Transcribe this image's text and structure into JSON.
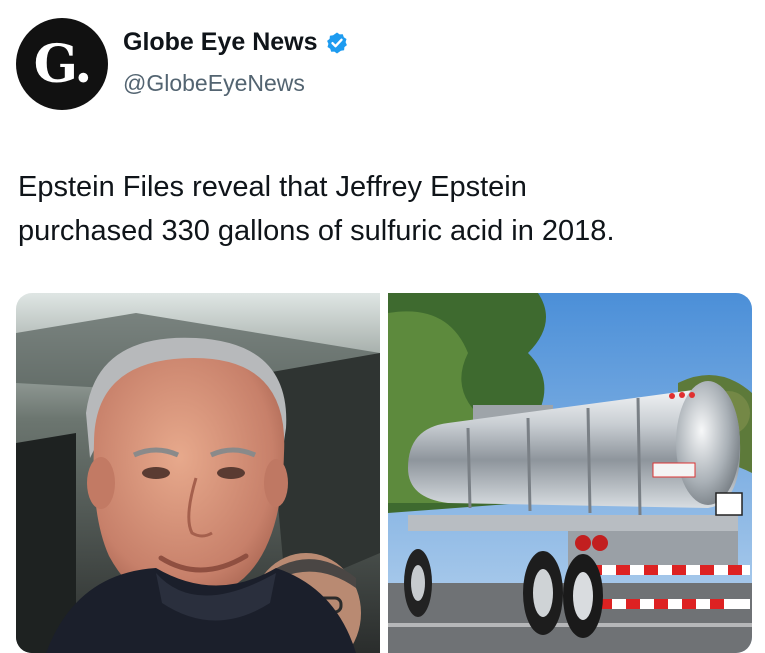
{
  "account": {
    "avatar_text": "G.",
    "display_name": "Globe Eye News",
    "handle": "@GlobeEyeNews",
    "verified": true,
    "verified_color": "#1d9bf0"
  },
  "post": {
    "text_line1": "Epstein Files reveal that Jeffrey Epstein",
    "text_line2": "purchased 330 gallons of sulfuric acid in 2018."
  },
  "media": {
    "image1": "portrait-photo",
    "image2": "tanker-truck-photo"
  }
}
